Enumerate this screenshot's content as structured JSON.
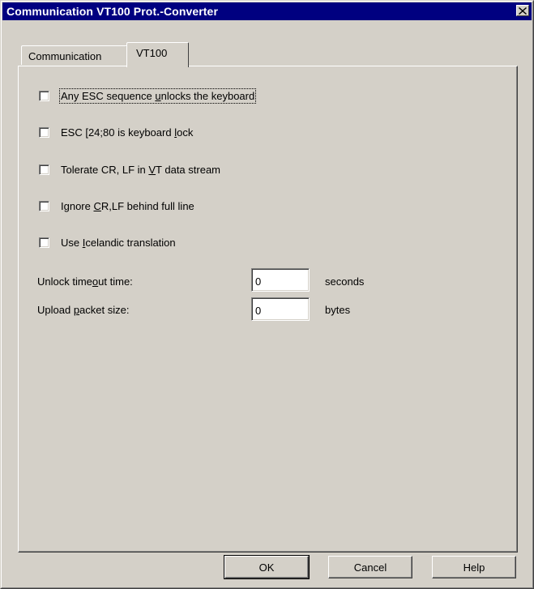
{
  "window": {
    "title": "Communication VT100 Prot.-Converter",
    "close_glyph": "✕"
  },
  "tabs": [
    {
      "label": "Communication",
      "active": false
    },
    {
      "label": "VT100",
      "active": true
    }
  ],
  "options": [
    {
      "pre": "Any ESC sequence ",
      "mnemonic": "u",
      "post": "nlocks the keyboard",
      "checked": false,
      "focused": true
    },
    {
      "pre": "ESC [24;80 is keyboard ",
      "mnemonic": "l",
      "post": "ock",
      "checked": false
    },
    {
      "pre": "Tolerate CR, LF in ",
      "mnemonic": "V",
      "post": "T data stream",
      "checked": false
    },
    {
      "pre": "Ignore ",
      "mnemonic": "C",
      "post": "R,LF behind full line",
      "checked": false
    },
    {
      "pre": "Use ",
      "mnemonic": "I",
      "post": "celandic translation",
      "checked": false
    }
  ],
  "fields": {
    "unlock": {
      "label_pre": "Unlock time",
      "mnemonic": "o",
      "label_post": "ut time:",
      "value": "0",
      "unit": "seconds"
    },
    "upload": {
      "label_pre": "Upload ",
      "mnemonic": "p",
      "label_post": "acket size:",
      "value": "0",
      "unit": "bytes"
    }
  },
  "buttons": {
    "ok": "OK",
    "cancel": "Cancel",
    "help": "Help"
  },
  "icons": {
    "close": "close-icon"
  },
  "colors": {
    "titlebar": "#000080",
    "face": "#d4d0c8"
  }
}
